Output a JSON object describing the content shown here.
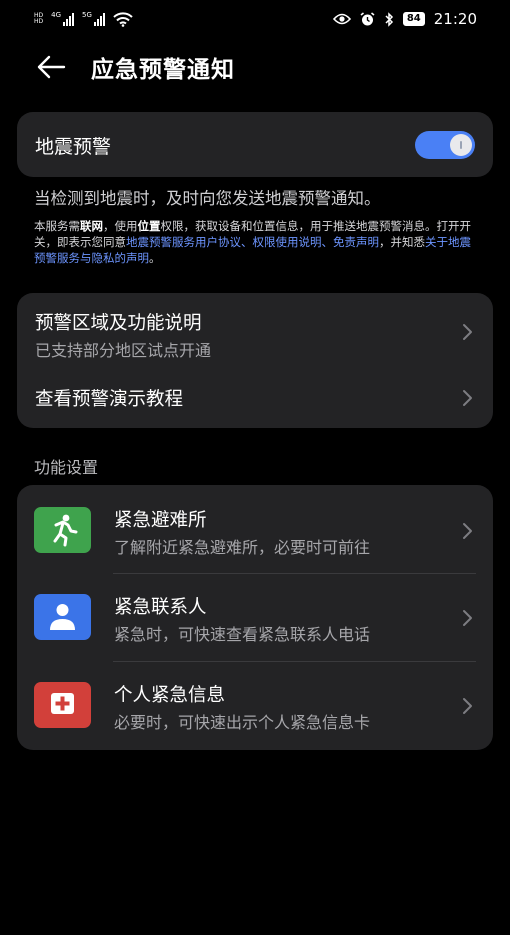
{
  "status_bar": {
    "left_tiny_1": "HD",
    "left_tiny_2": "HD",
    "network_1": "4G",
    "network_2": "5G",
    "battery": "84",
    "time": "21:20"
  },
  "header": {
    "title": "应急预警通知"
  },
  "earthquake_toggle": {
    "label": "地震预警",
    "enabled": true,
    "accent_color": "#4a80f5"
  },
  "description": "当检测到地震时，及时向您发送地震预警通知。",
  "notice": {
    "part1": "本服务需",
    "bold1": "联网",
    "part2": "，使用",
    "bold2": "位置",
    "part3": "权限，获取设备和位置信息，用于推送地震预警消息。打开开关，即表示您同意",
    "link1": "地震预警服务用户协议",
    "sep1": "、",
    "link2": "权限使用说明",
    "sep2": "、",
    "link3": "免责声明",
    "part4": "，并知悉",
    "link4": "关于地震预警服务与隐私的声明",
    "end": "。"
  },
  "info_card": {
    "items": [
      {
        "title": "预警区域及功能说明",
        "subtitle": "已支持部分地区试点开通"
      },
      {
        "title": "查看预警演示教程"
      }
    ]
  },
  "section_title": "功能设置",
  "settings": [
    {
      "icon": "running-person-icon",
      "color": "#3fa34d",
      "title": "紧急避难所",
      "subtitle": "了解附近紧急避难所，必要时可前往"
    },
    {
      "icon": "contact-person-icon",
      "color": "#3b74e8",
      "title": "紧急联系人",
      "subtitle": "紧急时，可快速查看紧急联系人电话"
    },
    {
      "icon": "medical-cross-icon",
      "color": "#d2403a",
      "title": "个人紧急信息",
      "subtitle": "必要时，可快速出示个人紧急信息卡"
    }
  ]
}
